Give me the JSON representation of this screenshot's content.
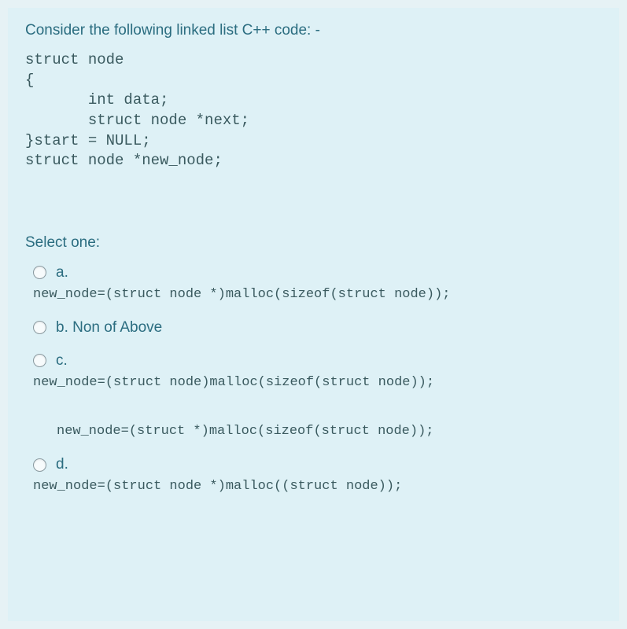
{
  "question": {
    "title": "Consider the following linked list C++ code: -",
    "code_lines": [
      "struct node",
      "",
      "{",
      "       int data;",
      "       struct node *next;",
      "}start = NULL;",
      "struct node *new_node;"
    ]
  },
  "select_one": "Select one:",
  "options": {
    "a": {
      "label": "a.",
      "code": "new_node=(struct node *)malloc(sizeof(struct node));"
    },
    "b": {
      "label": "b. Non of Above"
    },
    "c": {
      "label": "c.",
      "code": "new_node=(struct node)malloc(sizeof(struct node));",
      "extra_code": "new_node=(struct *)malloc(sizeof(struct node));"
    },
    "d": {
      "label": "d.",
      "code": "new_node=(struct node *)malloc((struct node));"
    }
  }
}
